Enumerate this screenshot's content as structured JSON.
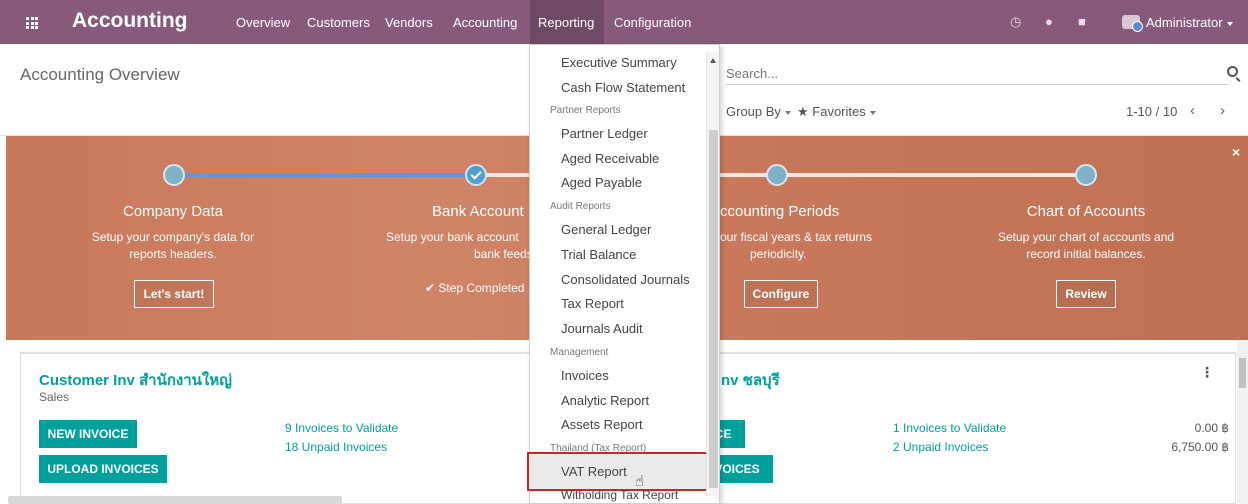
{
  "navbar": {
    "brand": "Accounting",
    "menus": [
      "Overview",
      "Customers",
      "Vendors",
      "Accounting",
      "Reporting",
      "Configuration"
    ],
    "active_menu": "Reporting",
    "user": "Administrator",
    "bg_color": "#875a7b"
  },
  "control_panel": {
    "breadcrumb": "Accounting Overview",
    "search_placeholder": "Search...",
    "group_by": "Group By",
    "favorites": "Favorites",
    "pager": "1-10 / 10"
  },
  "setup_banner": {
    "steps": [
      {
        "title": "Company Data",
        "desc1": "Setup your company's data for",
        "desc2": "reports headers.",
        "button": "Let's start!"
      },
      {
        "title": "Bank Account",
        "desc1": "Setup your bank account",
        "desc2": "bank feeds.",
        "status": "Step Completed"
      },
      {
        "title": "ccounting Periods",
        "desc1": "our fiscal years & tax returns",
        "desc2": "periodicity.",
        "button": "Configure"
      },
      {
        "title": "Chart of Accounts",
        "desc1": "Setup your chart of accounts and",
        "desc2": "record initial balances.",
        "button": "Review"
      }
    ]
  },
  "cards": {
    "left": {
      "title": "Customer Inv สำนักงานใหญ่",
      "subtitle": "Sales",
      "new_invoice": "NEW INVOICE",
      "upload_invoices": "UPLOAD INVOICES",
      "to_validate": "9 Invoices to Validate",
      "unpaid": "18 Unpaid Invoices"
    },
    "right": {
      "title": "nv ชลบุรี",
      "btn_partial_1": "CE",
      "btn_partial_2": "VOICES",
      "to_validate": "1 Invoices to Validate",
      "unpaid": "2 Unpaid Invoices",
      "amount_validate": "0.00 ฿",
      "amount_unpaid": "6,750.00 ฿"
    }
  },
  "reporting_menu": {
    "items_top": [
      "Executive Summary",
      "Cash Flow Statement"
    ],
    "partner_header": "Partner Reports",
    "partner_items": [
      "Partner Ledger",
      "Aged Receivable",
      "Aged Payable"
    ],
    "audit_header": "Audit Reports",
    "audit_items": [
      "General Ledger",
      "Trial Balance",
      "Consolidated Journals",
      "Tax Report",
      "Journals Audit"
    ],
    "management_header": "Management",
    "management_items": [
      "Invoices",
      "Analytic Report",
      "Assets Report"
    ],
    "thailand_header": "Thailand (Tax Report)",
    "thailand_items": [
      "VAT Report",
      "Witholding Tax Report"
    ],
    "highlighted": "VAT Report"
  }
}
